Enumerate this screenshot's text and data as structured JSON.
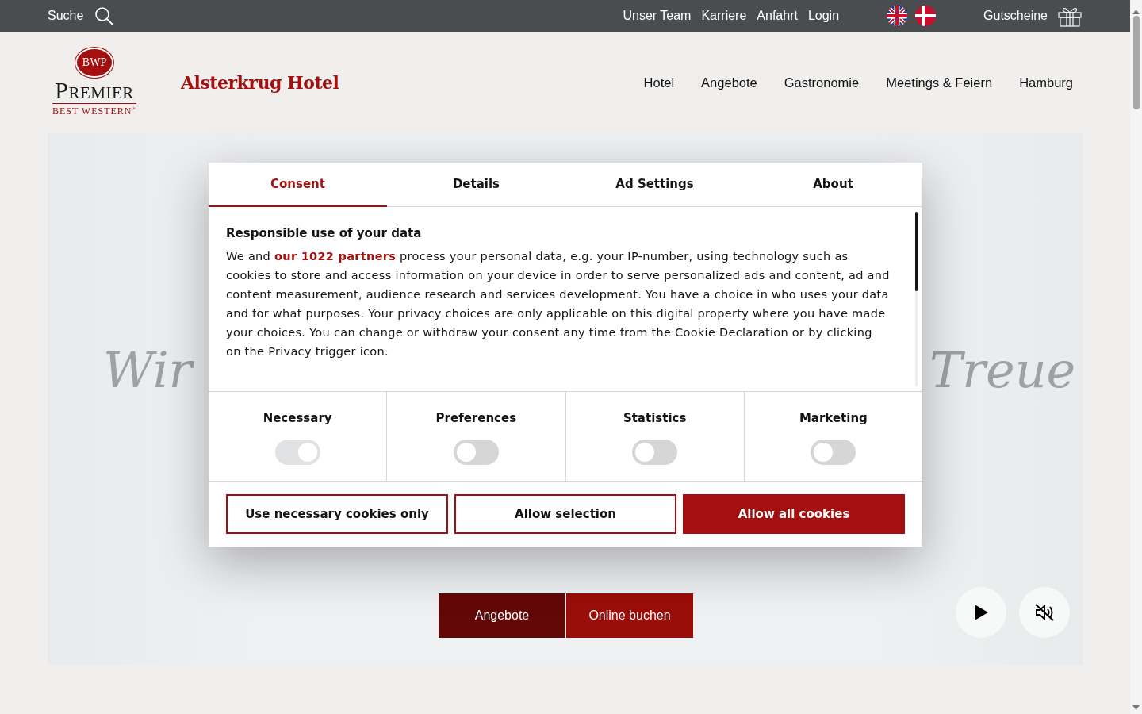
{
  "top_bar": {
    "search_label": "Suche",
    "links": [
      "Unser Team",
      "Karriere",
      "Anfahrt",
      "Login"
    ],
    "languages": [
      {
        "kind": "uk"
      },
      {
        "kind": "dk"
      }
    ],
    "vouchers": "Gutscheine"
  },
  "header": {
    "logo": {
      "badge": "BWP",
      "brand": "Premier",
      "sub": "BEST WESTERN",
      "mark": "®"
    },
    "hotel_name": "Alsterkrug Hotel",
    "nav": [
      "Hotel",
      "Angebote",
      "Gastronomie",
      "Meetings & Feiern",
      "Hamburg"
    ]
  },
  "hero": {
    "script_left": "Wir",
    "script_right": "Treue",
    "buttons": [
      {
        "label": "Angebote",
        "kind": "dark"
      },
      {
        "label": "Online buchen",
        "kind": "primary"
      }
    ],
    "media_controls": [
      {
        "kind": "play"
      },
      {
        "kind": "mute"
      }
    ]
  },
  "consent_dialog": {
    "tabs": [
      {
        "label": "Consent",
        "selected": true
      },
      {
        "label": "Details",
        "selected": false
      },
      {
        "label": "Ad Settings",
        "selected": false
      },
      {
        "label": "About",
        "selected": false
      }
    ],
    "heading": "Responsible use of your data",
    "text_before": "We and ",
    "link": "our 1022 partners",
    "text_after": " process your personal data, e.g. your IP-number, using technology such as cookies to store and access information on your device in order to serve personalized ads and content, ad and content measurement, audience research and services development. You have a choice in who uses your data and for what purposes. Your privacy choices are only applicable on this digital property where you have made your choices. You can change or withdraw your consent any time from the Cookie Declaration or by clicking on the Privacy trigger icon.",
    "categories": [
      {
        "label": "Necessary",
        "on": true,
        "disabled": true
      },
      {
        "label": "Preferences",
        "on": false,
        "disabled": false
      },
      {
        "label": "Statistics",
        "on": false,
        "disabled": false
      },
      {
        "label": "Marketing",
        "on": false,
        "disabled": false
      }
    ],
    "buttons": [
      {
        "label": "Use necessary cookies only",
        "kind": "outline"
      },
      {
        "label": "Allow selection",
        "kind": "outline"
      },
      {
        "label": "Allow all cookies",
        "kind": "primary"
      }
    ]
  }
}
